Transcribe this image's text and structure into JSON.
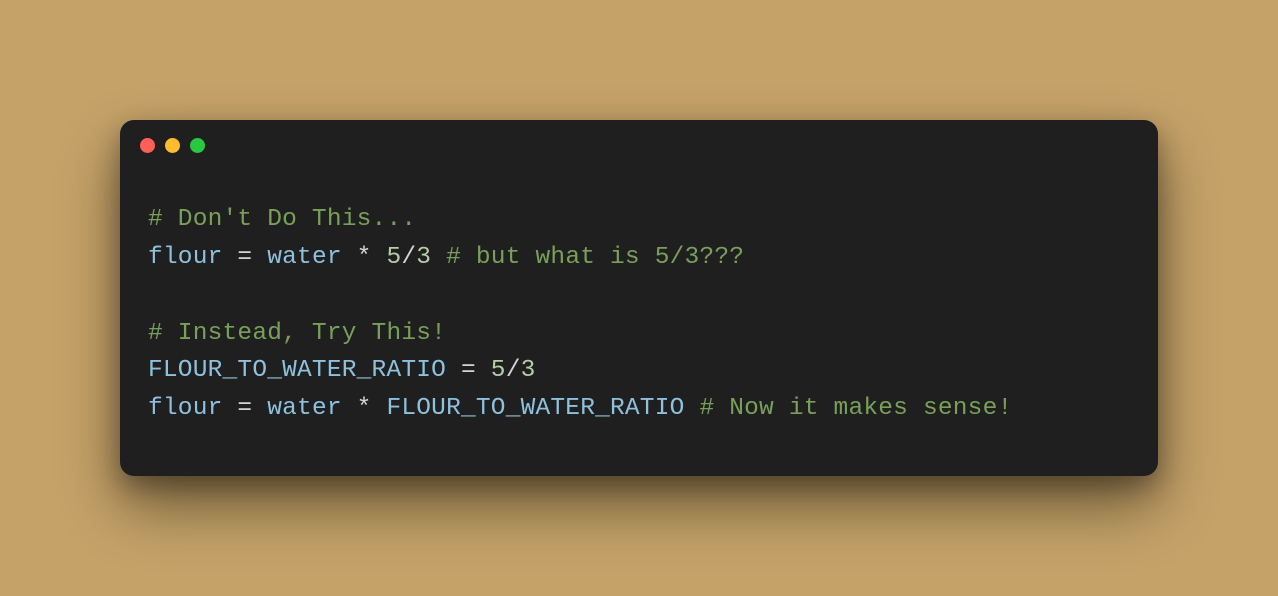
{
  "titlebar": {
    "close": "close",
    "minimize": "minimize",
    "maximize": "maximize"
  },
  "code": {
    "line1": {
      "comment": "# Don't Do This..."
    },
    "line2": {
      "var1": "flour",
      "op1": " = ",
      "var2": "water",
      "op2": " * ",
      "num1": "5",
      "op3": "/",
      "num2": "3",
      "space": " ",
      "comment": "# but what is 5/3???"
    },
    "line3": "",
    "line4": {
      "comment": "# Instead, Try This!"
    },
    "line5": {
      "var1": "FLOUR_TO_WATER_RATIO",
      "op1": " = ",
      "num1": "5",
      "op2": "/",
      "num2": "3"
    },
    "line6": {
      "var1": "flour",
      "op1": " = ",
      "var2": "water",
      "op2": " * ",
      "var3": "FLOUR_TO_WATER_RATIO",
      "space": " ",
      "comment": "# Now it makes sense!"
    }
  }
}
